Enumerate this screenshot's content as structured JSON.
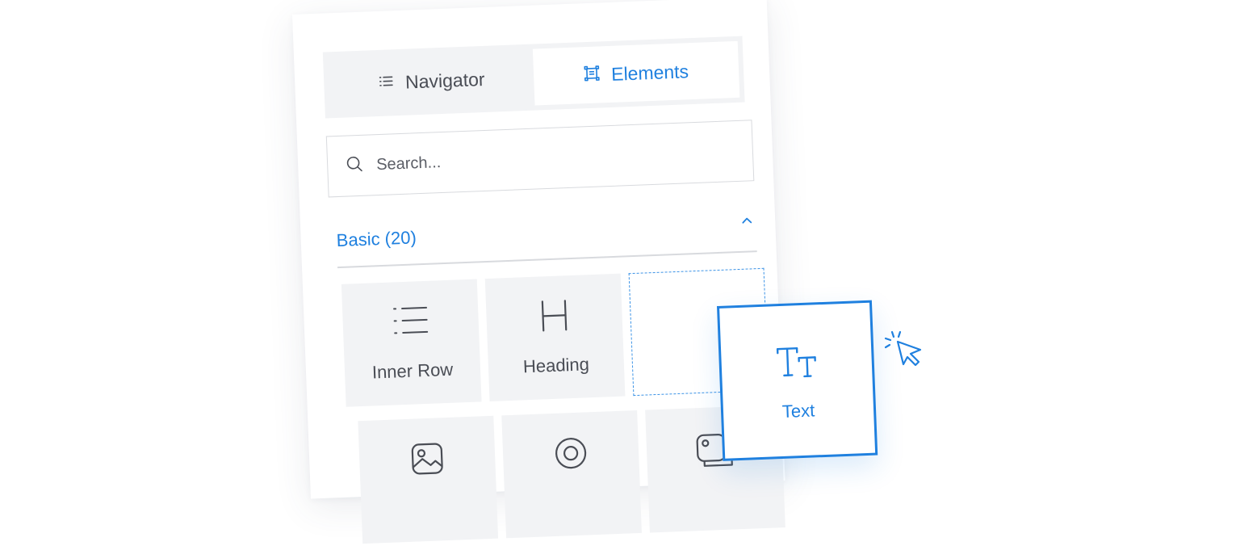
{
  "tabs": [
    {
      "label": "Navigator",
      "icon": "list-icon",
      "active": false
    },
    {
      "label": "Elements",
      "icon": "elements-icon",
      "active": true
    }
  ],
  "search": {
    "placeholder": "Search..."
  },
  "section": {
    "title": "Basic (20)",
    "icon": "chevron-up-icon"
  },
  "tiles": [
    {
      "label": "Inner Row",
      "icon": "inner-row-icon"
    },
    {
      "label": "Heading",
      "icon": "heading-icon"
    },
    {
      "label": "",
      "icon": "",
      "drop_target": true
    },
    {
      "label": "",
      "icon": "image-icon"
    },
    {
      "label": "",
      "icon": "radio-icon"
    },
    {
      "label": "",
      "icon": "gallery-icon"
    }
  ],
  "drag_card": {
    "label": "Text",
    "icon": "text-type-icon"
  },
  "colors": {
    "accent": "#1f80df",
    "text": "#4a4d55",
    "tile_bg": "#f2f3f5",
    "border": "#d8dade"
  }
}
